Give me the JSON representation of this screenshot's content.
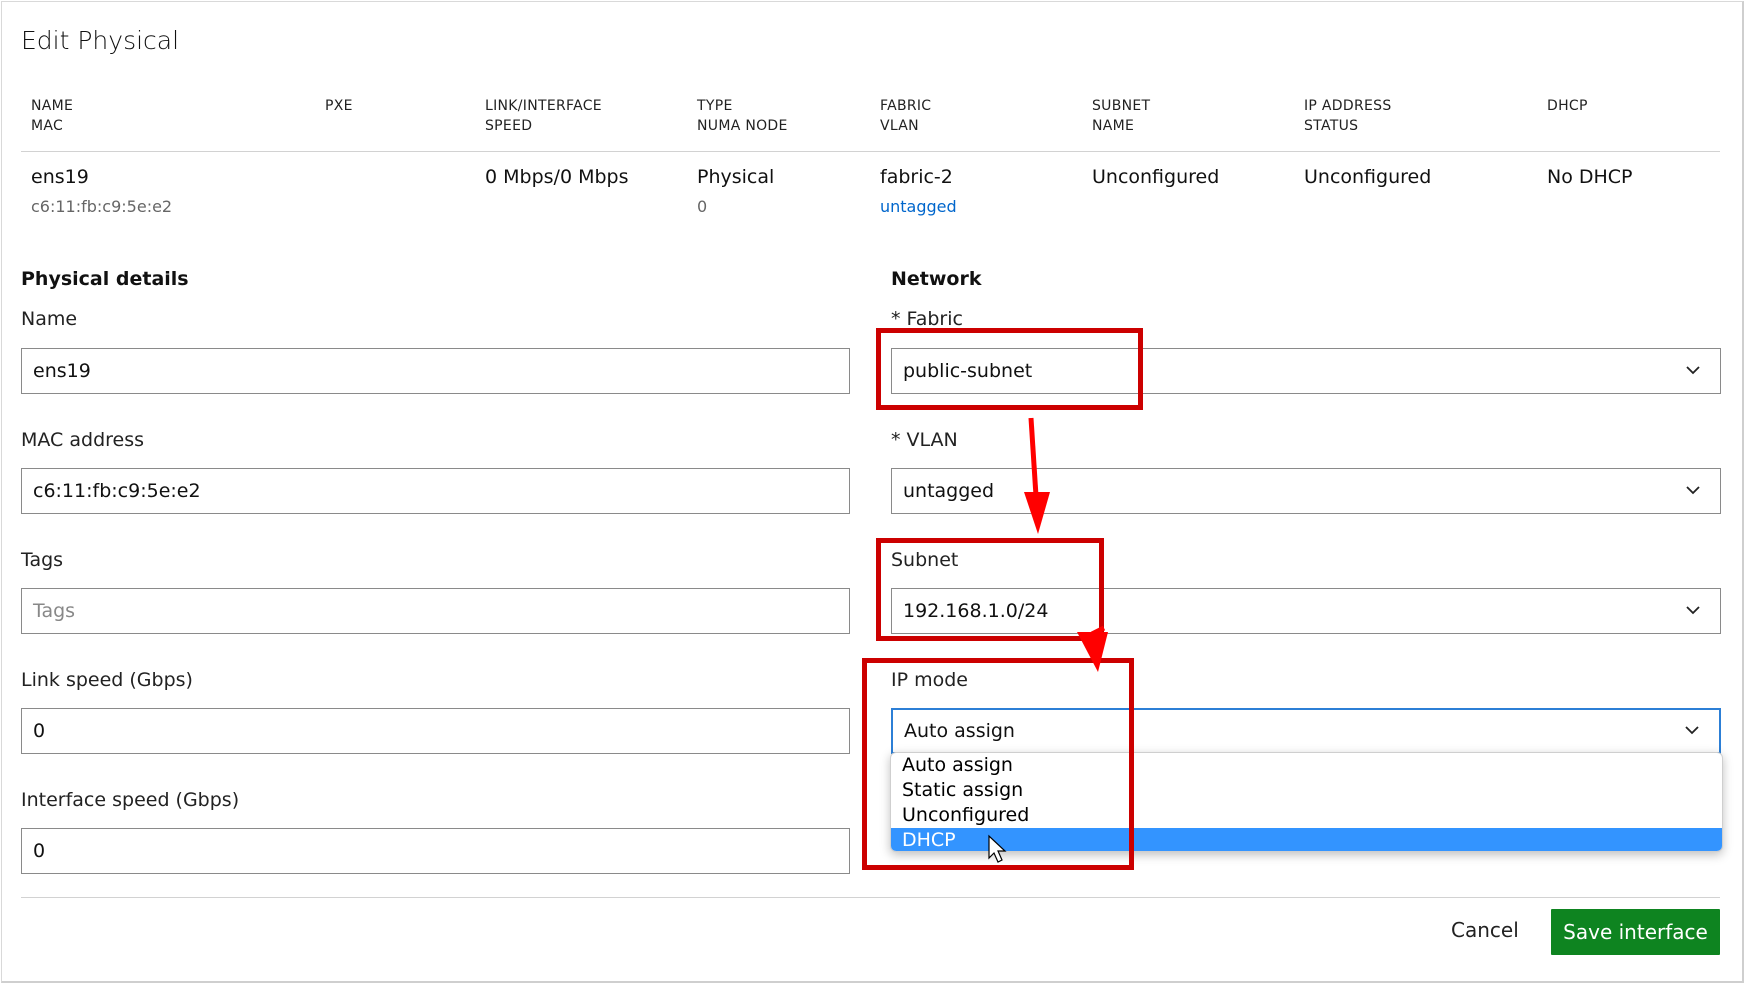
{
  "dialog": {
    "title": "Edit Physical"
  },
  "table": {
    "headers": [
      {
        "line1": "NAME",
        "line2": "MAC"
      },
      {
        "line1": "PXE",
        "line2": ""
      },
      {
        "line1": "LINK/INTERFACE",
        "line2": "SPEED"
      },
      {
        "line1": "TYPE",
        "line2": "NUMA NODE"
      },
      {
        "line1": "FABRIC",
        "line2": "VLAN"
      },
      {
        "line1": "SUBNET",
        "line2": "NAME"
      },
      {
        "line1": "IP ADDRESS",
        "line2": "STATUS"
      },
      {
        "line1": "DHCP",
        "line2": ""
      }
    ],
    "row": {
      "name": "ens19",
      "mac": "c6:11:fb:c9:5e:e2",
      "speed": "0 Mbps/0 Mbps",
      "type": "Physical",
      "numa_node": "0",
      "fabric": "fabric-2",
      "vlan": "untagged",
      "subnet": "Unconfigured",
      "ip_status": "Unconfigured",
      "dhcp": "No DHCP"
    }
  },
  "physical_details": {
    "heading": "Physical details",
    "name": {
      "label": "Name",
      "value": "ens19"
    },
    "mac": {
      "label": "MAC address",
      "value": "c6:11:fb:c9:5e:e2"
    },
    "tags": {
      "label": "Tags",
      "placeholder": "Tags"
    },
    "link_speed": {
      "label": "Link speed (Gbps)",
      "value": "0"
    },
    "interface_speed": {
      "label": "Interface speed (Gbps)",
      "value": "0"
    }
  },
  "network": {
    "heading": "Network",
    "fabric": {
      "label": "* Fabric",
      "value": "public-subnet"
    },
    "vlan": {
      "label": "* VLAN",
      "value": "untagged"
    },
    "subnet": {
      "label": "Subnet",
      "value": "192.168.1.0/24"
    },
    "ip_mode": {
      "label": "IP mode",
      "value": "Auto assign",
      "options": [
        "Auto assign",
        "Static assign",
        "Unconfigured",
        "DHCP"
      ],
      "highlighted_index": 3
    }
  },
  "footer": {
    "cancel_label": "Cancel",
    "save_label": "Save interface"
  },
  "colors": {
    "accent_green": "#0e8420",
    "highlight_blue": "#3394ff",
    "focus_blue": "#2c7fd6",
    "annotation_red": "#cc0000",
    "link_blue": "#0066cc"
  },
  "icons": {
    "select_arrow": "chevron-down-icon",
    "pointer": "mouse-cursor-icon"
  }
}
